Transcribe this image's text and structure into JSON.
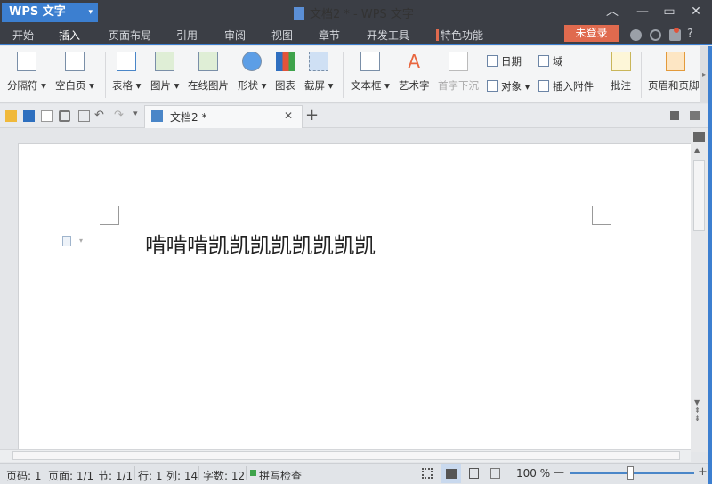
{
  "app": {
    "name": "WPS 文字",
    "dropdown": "▾"
  },
  "window": {
    "title": "文档2 * - WPS 文字",
    "collapse": "︿",
    "minimize": "—",
    "maximize": "▭",
    "close": "✕"
  },
  "menu": [
    "开始",
    "插入",
    "页面布局",
    "引用",
    "审阅",
    "视图",
    "章节",
    "开发工具",
    "特色功能"
  ],
  "login": "未登录",
  "help": "?",
  "ribbon": {
    "items": [
      {
        "label": "分隔符 ▾"
      },
      {
        "label": "空白页 ▾"
      },
      {
        "label": "表格 ▾"
      },
      {
        "label": "图片 ▾"
      },
      {
        "label": "在线图片"
      },
      {
        "label": "形状 ▾"
      },
      {
        "label": "图表"
      },
      {
        "label": "截屏 ▾"
      },
      {
        "label": "文本框 ▾"
      },
      {
        "label": "艺术字"
      },
      {
        "label": "首字下沉"
      },
      {
        "label": "批注"
      },
      {
        "label": "页眉和页脚"
      }
    ],
    "small": {
      "date": "日期",
      "field": "域",
      "object": "对象 ▾",
      "attachment": "插入附件"
    }
  },
  "doc_tab": {
    "title": "文档2 *",
    "close": "✕",
    "new": "+"
  },
  "document": {
    "text": "啃啃啃凯凯凯凯凯凯凯凯"
  },
  "status": {
    "page": "页码: 1",
    "pages": "页面: 1/1",
    "section": "节: 1/1",
    "row": "行: 1",
    "col": "列: 14",
    "words": "字数: 12",
    "spell": "拼写检查",
    "zoom": "100 %",
    "zoom_fraction": 0.5
  },
  "colors": {
    "accent": "#3c7fd0",
    "login": "#e06a4e",
    "titlebar": "#3b3e45"
  }
}
